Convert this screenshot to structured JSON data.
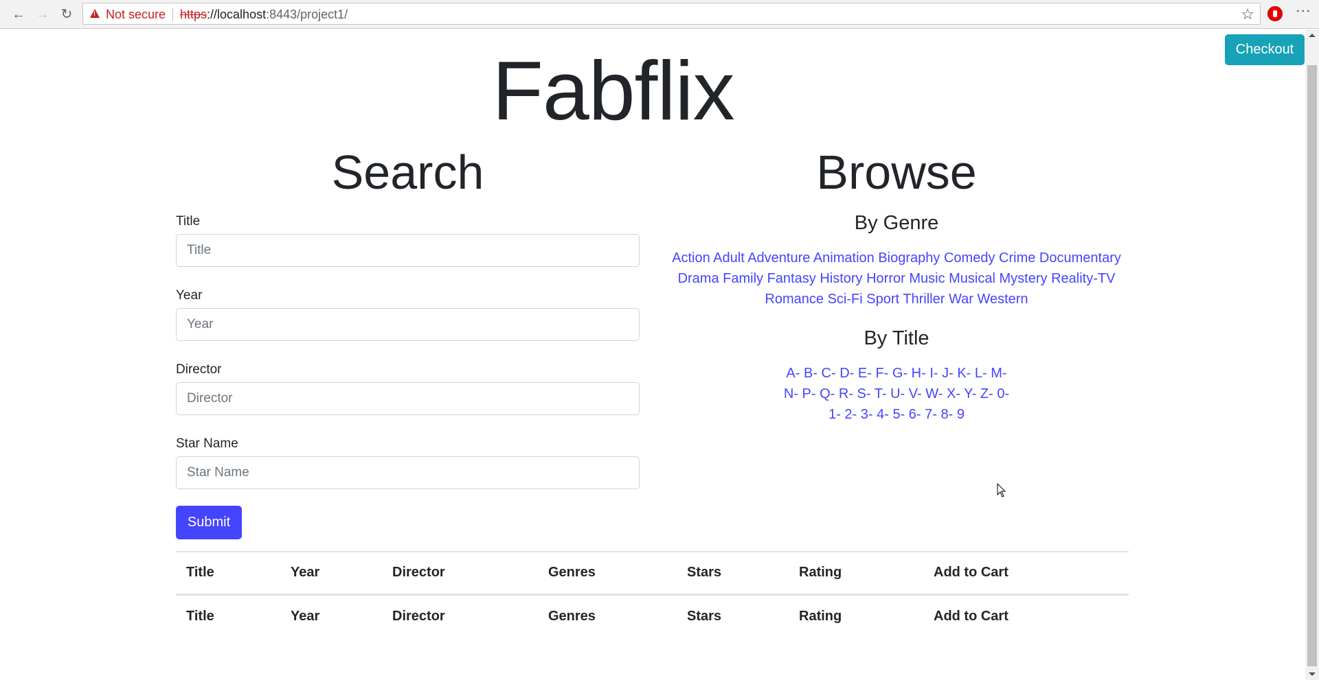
{
  "browser": {
    "security_label": "Not secure",
    "url_scheme": "https",
    "url_host": "://localhost",
    "url_rest": ":8443/project1/",
    "icons": [
      "back-icon",
      "forward-icon",
      "reload-icon",
      "warning-icon",
      "star-icon",
      "opera-extension-icon",
      "menu-icon"
    ]
  },
  "header": {
    "site_title": "Fabflix",
    "checkout_label": "Checkout"
  },
  "search": {
    "heading": "Search",
    "fields": [
      {
        "label": "Title",
        "placeholder": "Title",
        "value": ""
      },
      {
        "label": "Year",
        "placeholder": "Year",
        "value": ""
      },
      {
        "label": "Director",
        "placeholder": "Director",
        "value": ""
      },
      {
        "label": "Star Name",
        "placeholder": "Star Name",
        "value": ""
      }
    ],
    "submit_label": "Submit"
  },
  "browse": {
    "heading": "Browse",
    "by_genre_heading": "By Genre",
    "genres": [
      "Action",
      "Adult",
      "Adventure",
      "Animation",
      "Biography",
      "Comedy",
      "Crime",
      "Documentary",
      "Drama",
      "Family",
      "Fantasy",
      "History",
      "Horror",
      "Music",
      "Musical",
      "Mystery",
      "Reality-TV",
      "Romance",
      "Sci-Fi",
      "Sport",
      "Thriller",
      "War",
      "Western"
    ],
    "by_title_heading": "By Title",
    "letters": [
      "A",
      "B",
      "C",
      "D",
      "E",
      "F",
      "G",
      "H",
      "I",
      "J",
      "K",
      "L",
      "M",
      "N",
      "P",
      "Q",
      "R",
      "S",
      "T",
      "U",
      "V",
      "W",
      "X",
      "Y",
      "Z",
      "0",
      "1",
      "2",
      "3",
      "4",
      "5",
      "6",
      "7",
      "8",
      "9"
    ],
    "letter_separator": "- "
  },
  "results": {
    "columns": [
      "Title",
      "Year",
      "Director",
      "Genres",
      "Stars",
      "Rating",
      "Add to Cart"
    ],
    "header_rows": 2
  },
  "colors": {
    "link": "#4444ff",
    "submit": "#4444ff",
    "checkout": "#17a2b8",
    "not_secure": "#c5221f"
  }
}
